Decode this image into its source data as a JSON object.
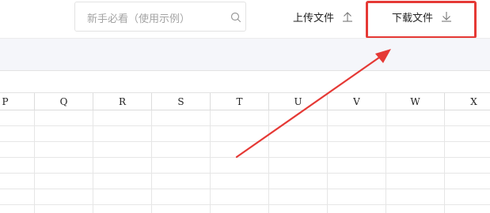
{
  "search": {
    "placeholder": "新手必看（使用示例）",
    "icon": "search-icon"
  },
  "toolbar": {
    "upload_label": "上传文件",
    "upload_icon": "upload-icon",
    "download_label": "下载文件",
    "download_icon": "download-icon"
  },
  "annotation": {
    "color": "#e53935",
    "target": "download-button"
  },
  "sheet": {
    "columns": [
      "P",
      "Q",
      "R",
      "S",
      "T",
      "U",
      "V",
      "W",
      "X"
    ]
  }
}
